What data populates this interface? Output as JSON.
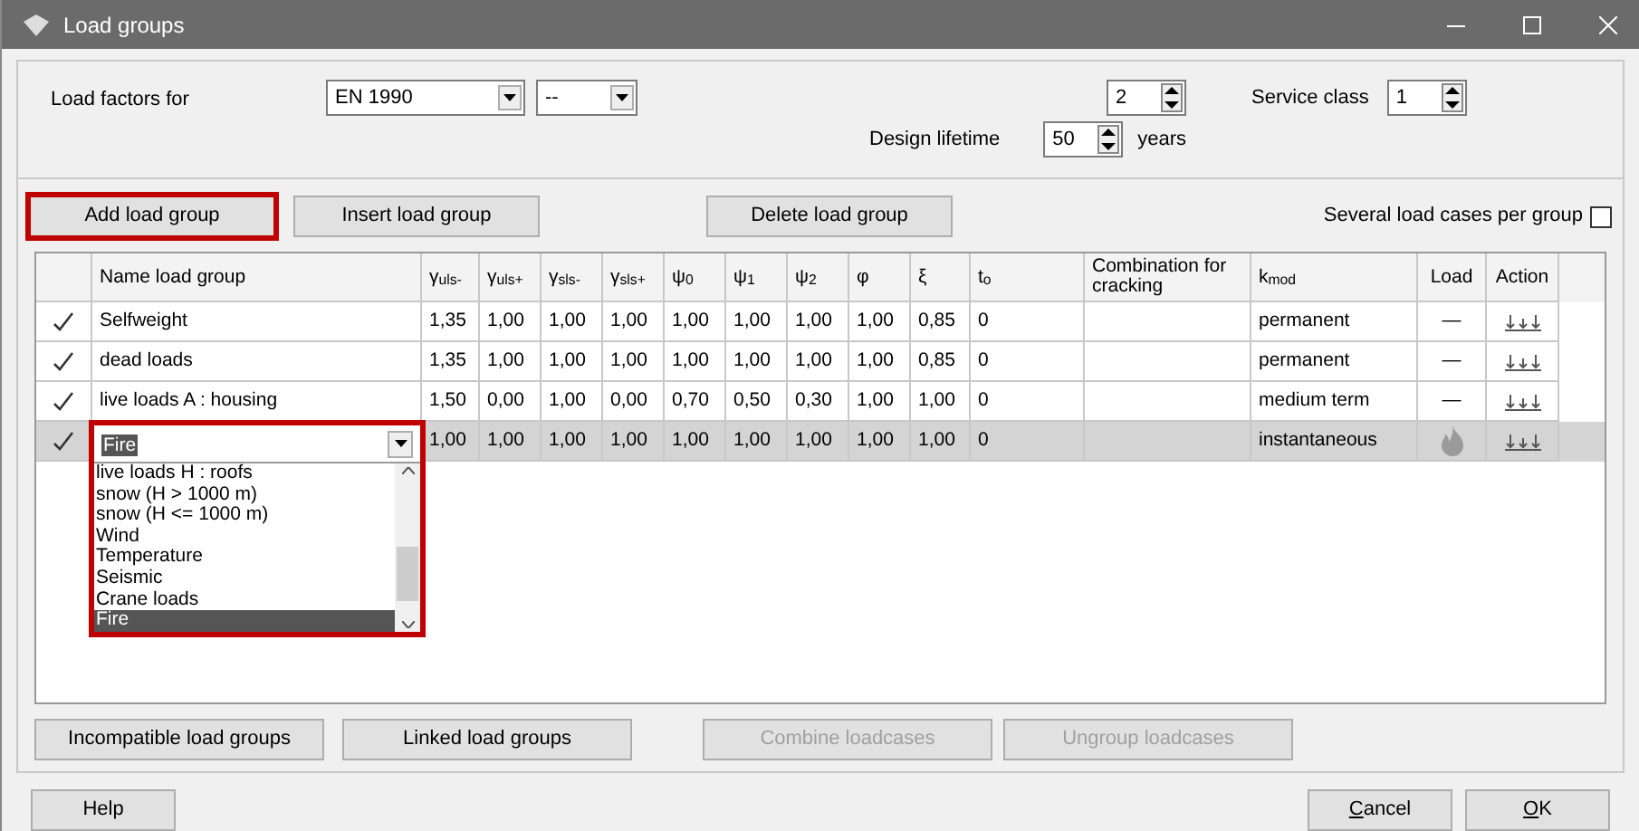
{
  "window": {
    "title": "Load groups"
  },
  "load_factors": {
    "label": "Load factors for",
    "standard": "EN 1990",
    "annex": "--",
    "spin_value": "2",
    "lifetime_label": "Design lifetime",
    "lifetime": "50",
    "lifetime_unit": "years",
    "service_class_label": "Service class",
    "service_class": "1"
  },
  "toolbar": [
    {
      "label": "Add load group",
      "highlighted": true
    },
    {
      "label": "Insert load group",
      "highlighted": false
    },
    {
      "label": "Delete load group",
      "highlighted": false
    }
  ],
  "several_cases": {
    "label": "Several load cases per group",
    "checked": false
  },
  "table": {
    "columns": [
      "Name load group",
      "γ$_{uls-}$",
      "γ$_{uls+}$",
      "γ$_{sls-}$",
      "γ$_{sls+}$",
      "ψ$_{0}$",
      "ψ$_{1}$",
      "ψ$_{2}$",
      "φ",
      "ξ",
      "t$_{o}$",
      "Combination for cracking",
      "k$_{mod}$",
      "Load",
      "Action"
    ],
    "rows": [
      {
        "checked": true,
        "selected": false,
        "name": "Selfweight",
        "values": [
          "1,35",
          "1,00",
          "1,00",
          "1,00",
          "1,00",
          "1,00",
          "1,00",
          "1,00",
          "0,85",
          "0"
        ],
        "kmod": "permanent",
        "load": {
          "kind": "text",
          "text": "—"
        }
      },
      {
        "checked": true,
        "selected": false,
        "name": "dead loads",
        "values": [
          "1,35",
          "1,00",
          "1,00",
          "1,00",
          "1,00",
          "1,00",
          "1,00",
          "1,00",
          "0,85",
          "0"
        ],
        "kmod": "permanent",
        "load": {
          "kind": "text",
          "text": "—"
        }
      },
      {
        "checked": true,
        "selected": false,
        "name": "live loads A : housing",
        "values": [
          "1,50",
          "0,00",
          "1,00",
          "0,00",
          "0,70",
          "0,50",
          "0,30",
          "1,00",
          "1,00",
          "0"
        ],
        "kmod": "medium term",
        "load": {
          "kind": "text",
          "text": "—"
        }
      },
      {
        "checked": true,
        "selected": true,
        "name": "Fire",
        "values": [
          "1,00",
          "1,00",
          "1,00",
          "1,00",
          "1,00",
          "1,00",
          "1,00",
          "1,00",
          "1,00",
          "0"
        ],
        "kmod": "instantaneous",
        "load": {
          "kind": "fire"
        }
      }
    ]
  },
  "dropdown": {
    "highlighted": true,
    "options": [
      {
        "label": "live loads H : roofs",
        "selected": false
      },
      {
        "label": "snow (H > 1000 m)",
        "selected": false
      },
      {
        "label": "snow (H <= 1000 m)",
        "selected": false
      },
      {
        "label": "Wind",
        "selected": false
      },
      {
        "label": "Temperature",
        "selected": false
      },
      {
        "label": "Seismic",
        "selected": false
      },
      {
        "label": "Crane loads",
        "selected": false
      },
      {
        "label": "Fire",
        "selected": true
      }
    ]
  },
  "bottom_buttons": [
    {
      "label": "Incompatible load groups",
      "disabled": false
    },
    {
      "label": "Linked load groups",
      "disabled": false
    },
    {
      "label": "Combine loadcases",
      "disabled": true
    },
    {
      "label": "Ungroup loadcases",
      "disabled": true
    }
  ],
  "footer": {
    "help": "Help",
    "cancel": "Cancel",
    "ok": "OK"
  }
}
